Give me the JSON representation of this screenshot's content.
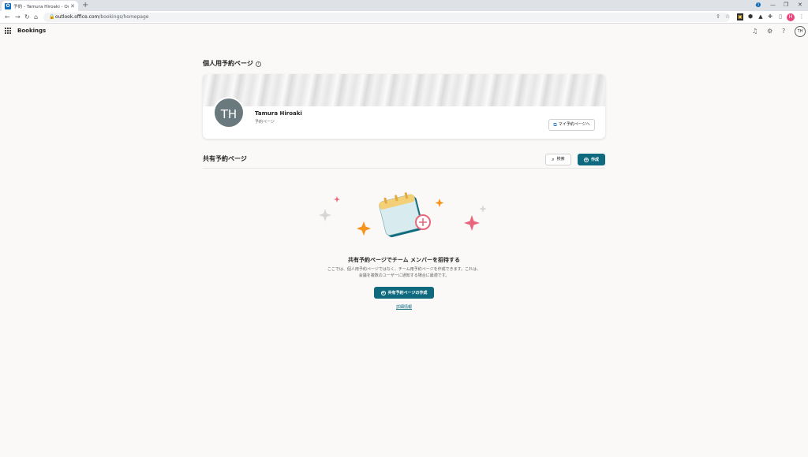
{
  "browser": {
    "tab_title": "予約 - Tamura Hiroaki - Outlook",
    "tab_favicon": "O",
    "url_host": "outlook.office.com",
    "url_path": "/bookings/homepage",
    "profile_initial": "H"
  },
  "app": {
    "name": "Bookings",
    "notification_count": "1",
    "user_initials": "TH"
  },
  "personal": {
    "title": "個人用予約ページ",
    "avatar_initials": "TH",
    "name": "Tamura Hiroaki",
    "subtitle": "予約ページ",
    "button_label": "マイ予約ページへ"
  },
  "shared": {
    "title": "共有予約ページ",
    "search_label": "検索",
    "create_label": "作成",
    "empty_title": "共有予約ページでチーム メンバーを招待する",
    "empty_desc": "ここでは、個人用予約ページではなく、チーム用予約ページを作成できます。これは、会議を複数のユーザーに通知する場合に最適です。",
    "create_shared_label": "共有予約ページの作成",
    "learn_more": "詳細情報"
  },
  "colors": {
    "accent": "#0f6a80",
    "avatar_bg": "#69797e",
    "sparkle_orange": "#f7941d",
    "sparkle_pink": "#e8677c",
    "sparkle_gray": "#d6d6d6"
  }
}
